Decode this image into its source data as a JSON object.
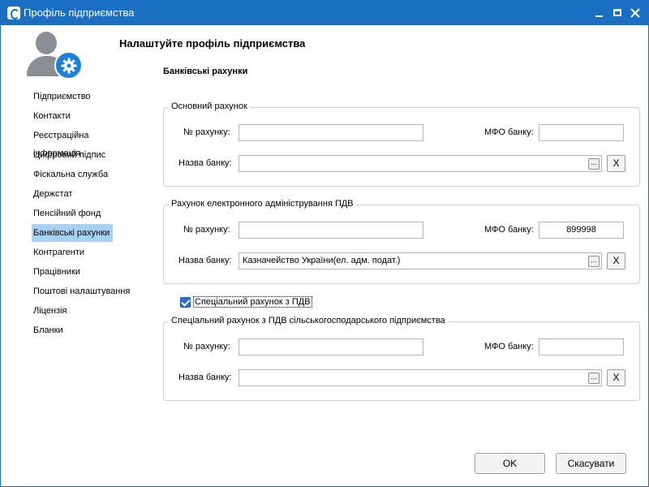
{
  "window": {
    "title": "Профіль підприємства"
  },
  "page": {
    "title": "Налаштуйте профіль підприємства",
    "section_title": "Банківські рахунки"
  },
  "nav": {
    "items": [
      {
        "label": "Підприємство",
        "active": false
      },
      {
        "label": "Контакти",
        "active": false
      },
      {
        "label": "Реєстраційна інформація",
        "active": false
      },
      {
        "label": "Цифровий підпис",
        "active": false
      },
      {
        "label": "Фіскальна служба",
        "active": false
      },
      {
        "label": "Держстат",
        "active": false
      },
      {
        "label": "Пенсійний фонд",
        "active": false
      },
      {
        "label": "Банківські рахунки",
        "active": true
      },
      {
        "label": "Контрагенти",
        "active": false
      },
      {
        "label": "Працівники",
        "active": false
      },
      {
        "label": "Поштові налаштування",
        "active": false
      },
      {
        "label": "Ліцензія",
        "active": false
      },
      {
        "label": "Бланки",
        "active": false
      }
    ]
  },
  "groups": {
    "main": {
      "legend": "Основний рахунок",
      "account_label": "№ рахунку:",
      "account_value": "",
      "mfo_label": "МФО банку:",
      "mfo_value": "",
      "bank_label": "Назва банку:",
      "bank_value": ""
    },
    "vat": {
      "legend": "Рахунок електронного адміністрування ПДВ",
      "account_label": "№ рахунку:",
      "account_value": "",
      "mfo_label": "МФО банку:",
      "mfo_value": "899998",
      "bank_label": "Назва банку:",
      "bank_value": "Казначейство України(ел. адм. подат.)"
    },
    "special": {
      "legend": "Спеціальний рахунок з ПДВ сільськогосподарського підприємства",
      "account_label": "№ рахунку:",
      "account_value": "",
      "mfo_label": "МФО банку:",
      "mfo_value": "",
      "bank_label": "Назва банку:",
      "bank_value": ""
    }
  },
  "special_checkbox": {
    "label": "Спеціальний рахунок з ПДВ",
    "checked": true
  },
  "buttons": {
    "browse": "...",
    "clear": "X",
    "ok": "OK",
    "cancel": "Скасувати"
  },
  "colors": {
    "titlebar": "#1a6fc2",
    "active_nav": "#a9d1f4",
    "gear": "#1e7fd8"
  },
  "icons": {
    "app": "app-logo-icon",
    "minimize": "minimize-icon",
    "maximize": "maximize-icon",
    "close": "close-icon",
    "avatar": "user-settings-icon",
    "browse": "ellipsis-icon",
    "clear": "clear-x-icon"
  }
}
